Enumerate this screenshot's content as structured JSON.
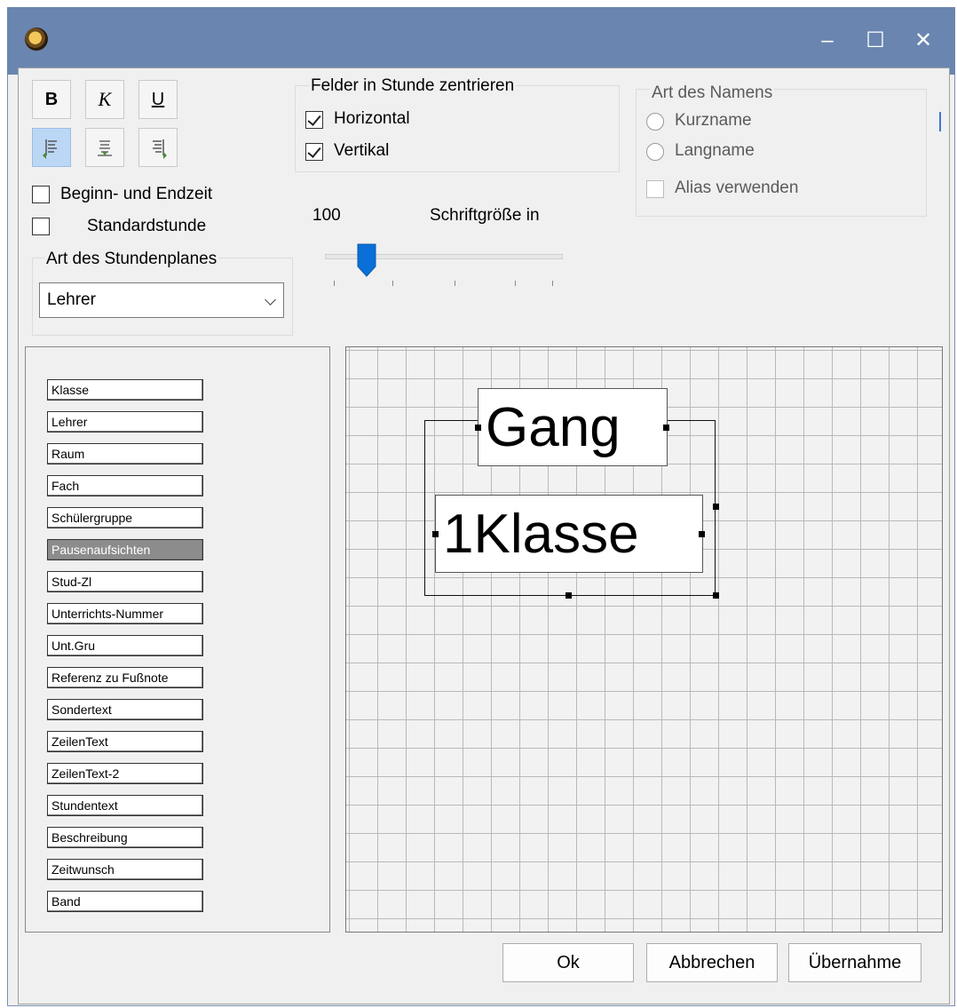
{
  "window": {
    "title": "",
    "controls": {
      "minimize": "–",
      "maximize": "☐",
      "close": "✕"
    }
  },
  "format": {
    "bold": "B",
    "italic": "K",
    "underline": "U",
    "align_buttons": [
      "align-left",
      "align-center",
      "align-right"
    ],
    "active_align": "align-left"
  },
  "options": {
    "begin_end_time": {
      "label": "Beginn- und Endzeit",
      "checked": false
    },
    "standard_hour": {
      "label": "Standardstunde",
      "checked": false
    }
  },
  "center_group": {
    "title": "Felder in Stunde zentrieren",
    "horizontal": {
      "label": "Horizontal",
      "checked": true
    },
    "vertical": {
      "label": "Vertikal",
      "checked": true
    }
  },
  "font_size": {
    "value": "100",
    "label": "Schriftgröße in",
    "slider_fraction": 0.14
  },
  "name_type": {
    "title": "Art des Namens",
    "short": "Kurzname",
    "long": "Langname",
    "alias": "Alias verwenden"
  },
  "timetable_type": {
    "title": "Art des Stundenplanes",
    "value": "Lehrer"
  },
  "fields": [
    "Klasse",
    "Lehrer",
    "Raum",
    "Fach",
    "Schülergruppe",
    "Pausenaufsichten",
    "Stud-Zl",
    "Unterrichts-Nummer",
    "Unt.Gru",
    "Referenz zu Fußnote",
    "Sondertext",
    "ZeilenText",
    "ZeilenText-2",
    "Stundentext",
    "Beschreibung",
    "Zeitwunsch",
    "Band"
  ],
  "selected_field": "Pausenaufsichten",
  "canvas": {
    "box1": "Gang",
    "box2": "1Klasse"
  },
  "buttons": {
    "ok": "Ok",
    "cancel": "Abbrechen",
    "apply": "Übernahme"
  },
  "colors": {
    "titlebar": "#6a85b0",
    "accent": "#0a6fd6",
    "active_button": "#bcd7f5"
  }
}
